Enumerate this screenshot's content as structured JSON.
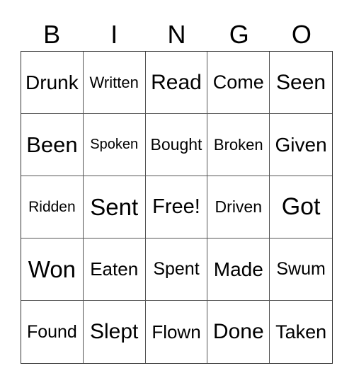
{
  "header": {
    "letters": [
      "B",
      "I",
      "N",
      "G",
      "O"
    ]
  },
  "grid": {
    "rows": [
      [
        "Drunk",
        "Written",
        "Read",
        "Come",
        "Seen"
      ],
      [
        "Been",
        "Spoken",
        "Bought",
        "Broken",
        "Given"
      ],
      [
        "Ridden",
        "Sent",
        "Free!",
        "Driven",
        "Got"
      ],
      [
        "Won",
        "Eaten",
        "Spent",
        "Made",
        "Swum"
      ],
      [
        "Found",
        "Slept",
        "Flown",
        "Done",
        "Taken"
      ]
    ]
  }
}
